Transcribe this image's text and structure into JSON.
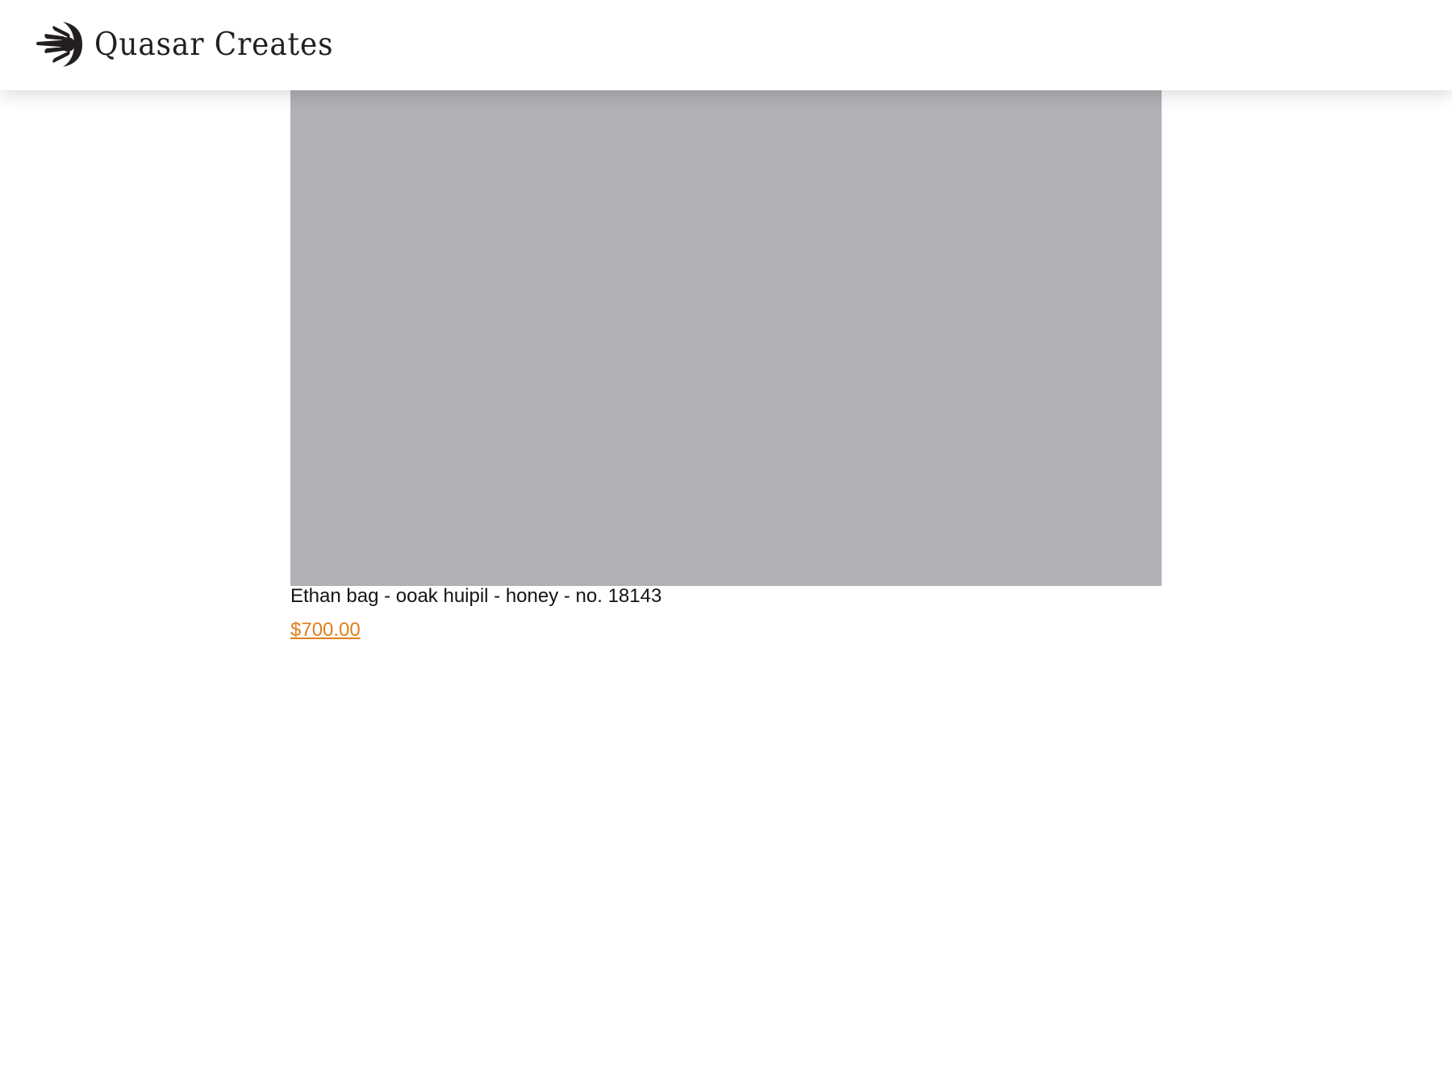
{
  "header": {
    "brand_name": "Quasar Creates",
    "logo_icon": "fanned-hand-logo-icon"
  },
  "product": {
    "title": "Ethan bag - ooak huipil - honey - no. 18143",
    "price": "$700.00",
    "image_placeholder_color": "#b0b1b5"
  },
  "colors": {
    "price_accent": "#e07f1c",
    "logo_ink": "#231f20"
  }
}
